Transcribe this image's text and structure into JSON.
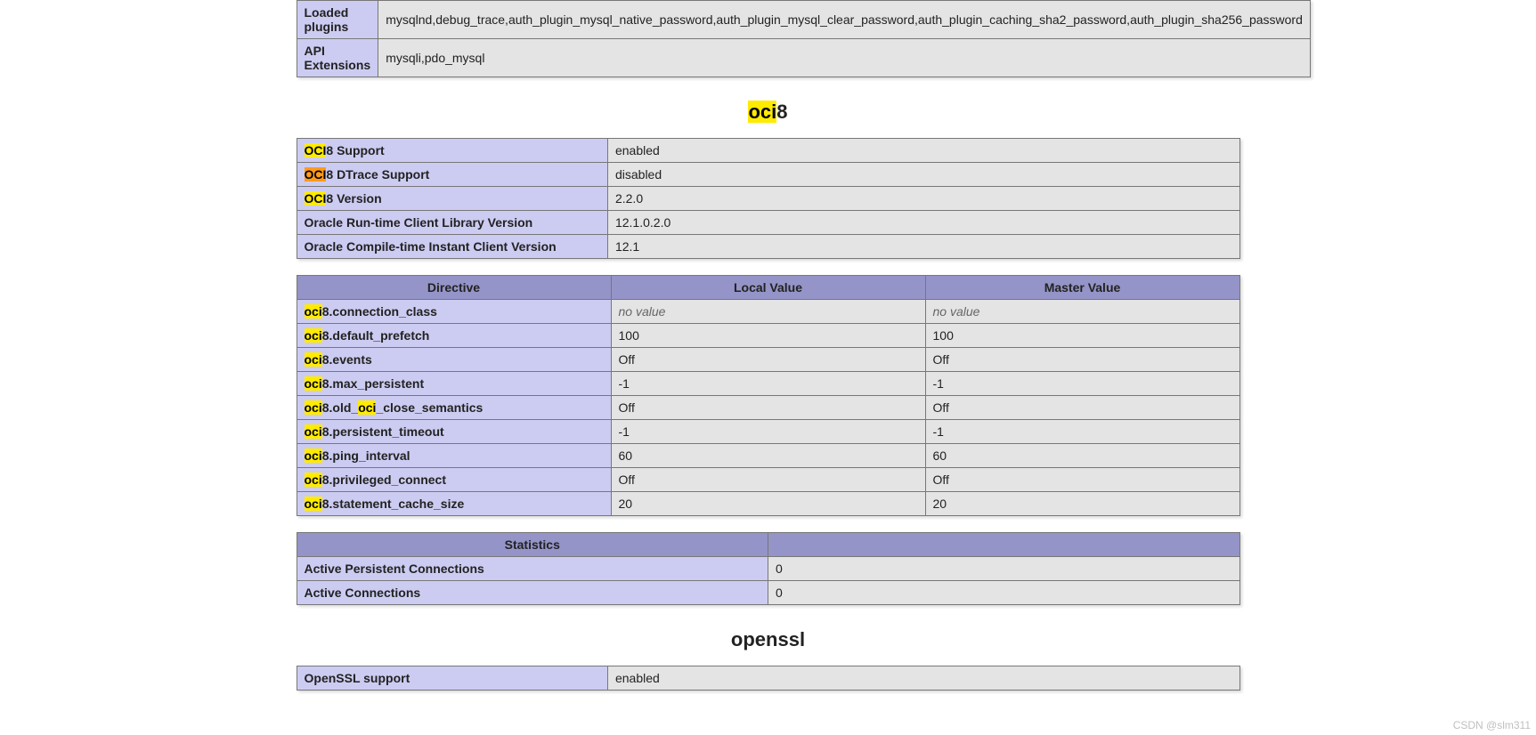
{
  "top_table": {
    "rows": [
      {
        "label": "Loaded plugins",
        "value": "mysqlnd,debug_trace,auth_plugin_mysql_native_password,auth_plugin_mysql_clear_password,auth_plugin_caching_sha2_password,auth_plugin_sha256_password"
      },
      {
        "label": "API Extensions",
        "value": "mysqli,pdo_mysql"
      }
    ]
  },
  "oci8_heading": {
    "hl": "oci",
    "rest": "8"
  },
  "oci8_info": {
    "rows": [
      {
        "label_hl": "OCI",
        "label_rest": "8 Support",
        "hl_class": "y",
        "value": "enabled"
      },
      {
        "label_hl": "OCI",
        "label_rest": "8 DTrace Support",
        "hl_class": "o",
        "value": "disabled"
      },
      {
        "label_hl": "OCI",
        "label_rest": "8 Version",
        "hl_class": "y",
        "value": "2.2.0"
      },
      {
        "label_hl": "",
        "label_rest": "Oracle Run-time Client Library Version",
        "hl_class": "",
        "value": "12.1.0.2.0"
      },
      {
        "label_hl": "",
        "label_rest": "Oracle Compile-time Instant Client Version",
        "hl_class": "",
        "value": "12.1"
      }
    ]
  },
  "directives": {
    "headers": {
      "c1": "Directive",
      "c2": "Local Value",
      "c3": "Master Value"
    },
    "rows": [
      {
        "d_hl": "oci",
        "d_rest": "8.connection_class",
        "local": "no value",
        "master": "no value",
        "italic": true
      },
      {
        "d_hl": "oci",
        "d_rest": "8.default_prefetch",
        "local": "100",
        "master": "100"
      },
      {
        "d_hl": "oci",
        "d_rest": "8.events",
        "local": "Off",
        "master": "Off"
      },
      {
        "d_hl": "oci",
        "d_rest": "8.max_persistent",
        "local": "-1",
        "master": "-1"
      },
      {
        "d_hl": "oci",
        "d_mid": "8.old_",
        "d_hl2": "oci",
        "d_rest": "_close_semantics",
        "local": "Off",
        "master": "Off"
      },
      {
        "d_hl": "oci",
        "d_rest": "8.persistent_timeout",
        "local": "-1",
        "master": "-1"
      },
      {
        "d_hl": "oci",
        "d_rest": "8.ping_interval",
        "local": "60",
        "master": "60"
      },
      {
        "d_hl": "oci",
        "d_rest": "8.privileged_connect",
        "local": "Off",
        "master": "Off"
      },
      {
        "d_hl": "oci",
        "d_rest": "8.statement_cache_size",
        "local": "20",
        "master": "20"
      }
    ]
  },
  "stats": {
    "header": "Statistics",
    "rows": [
      {
        "label": "Active Persistent Connections",
        "value": "0"
      },
      {
        "label": "Active Connections",
        "value": "0"
      }
    ]
  },
  "openssl_heading": "openssl",
  "openssl_info": {
    "rows": [
      {
        "label": "OpenSSL support",
        "value": "enabled"
      }
    ]
  },
  "watermark": "CSDN @slm311"
}
